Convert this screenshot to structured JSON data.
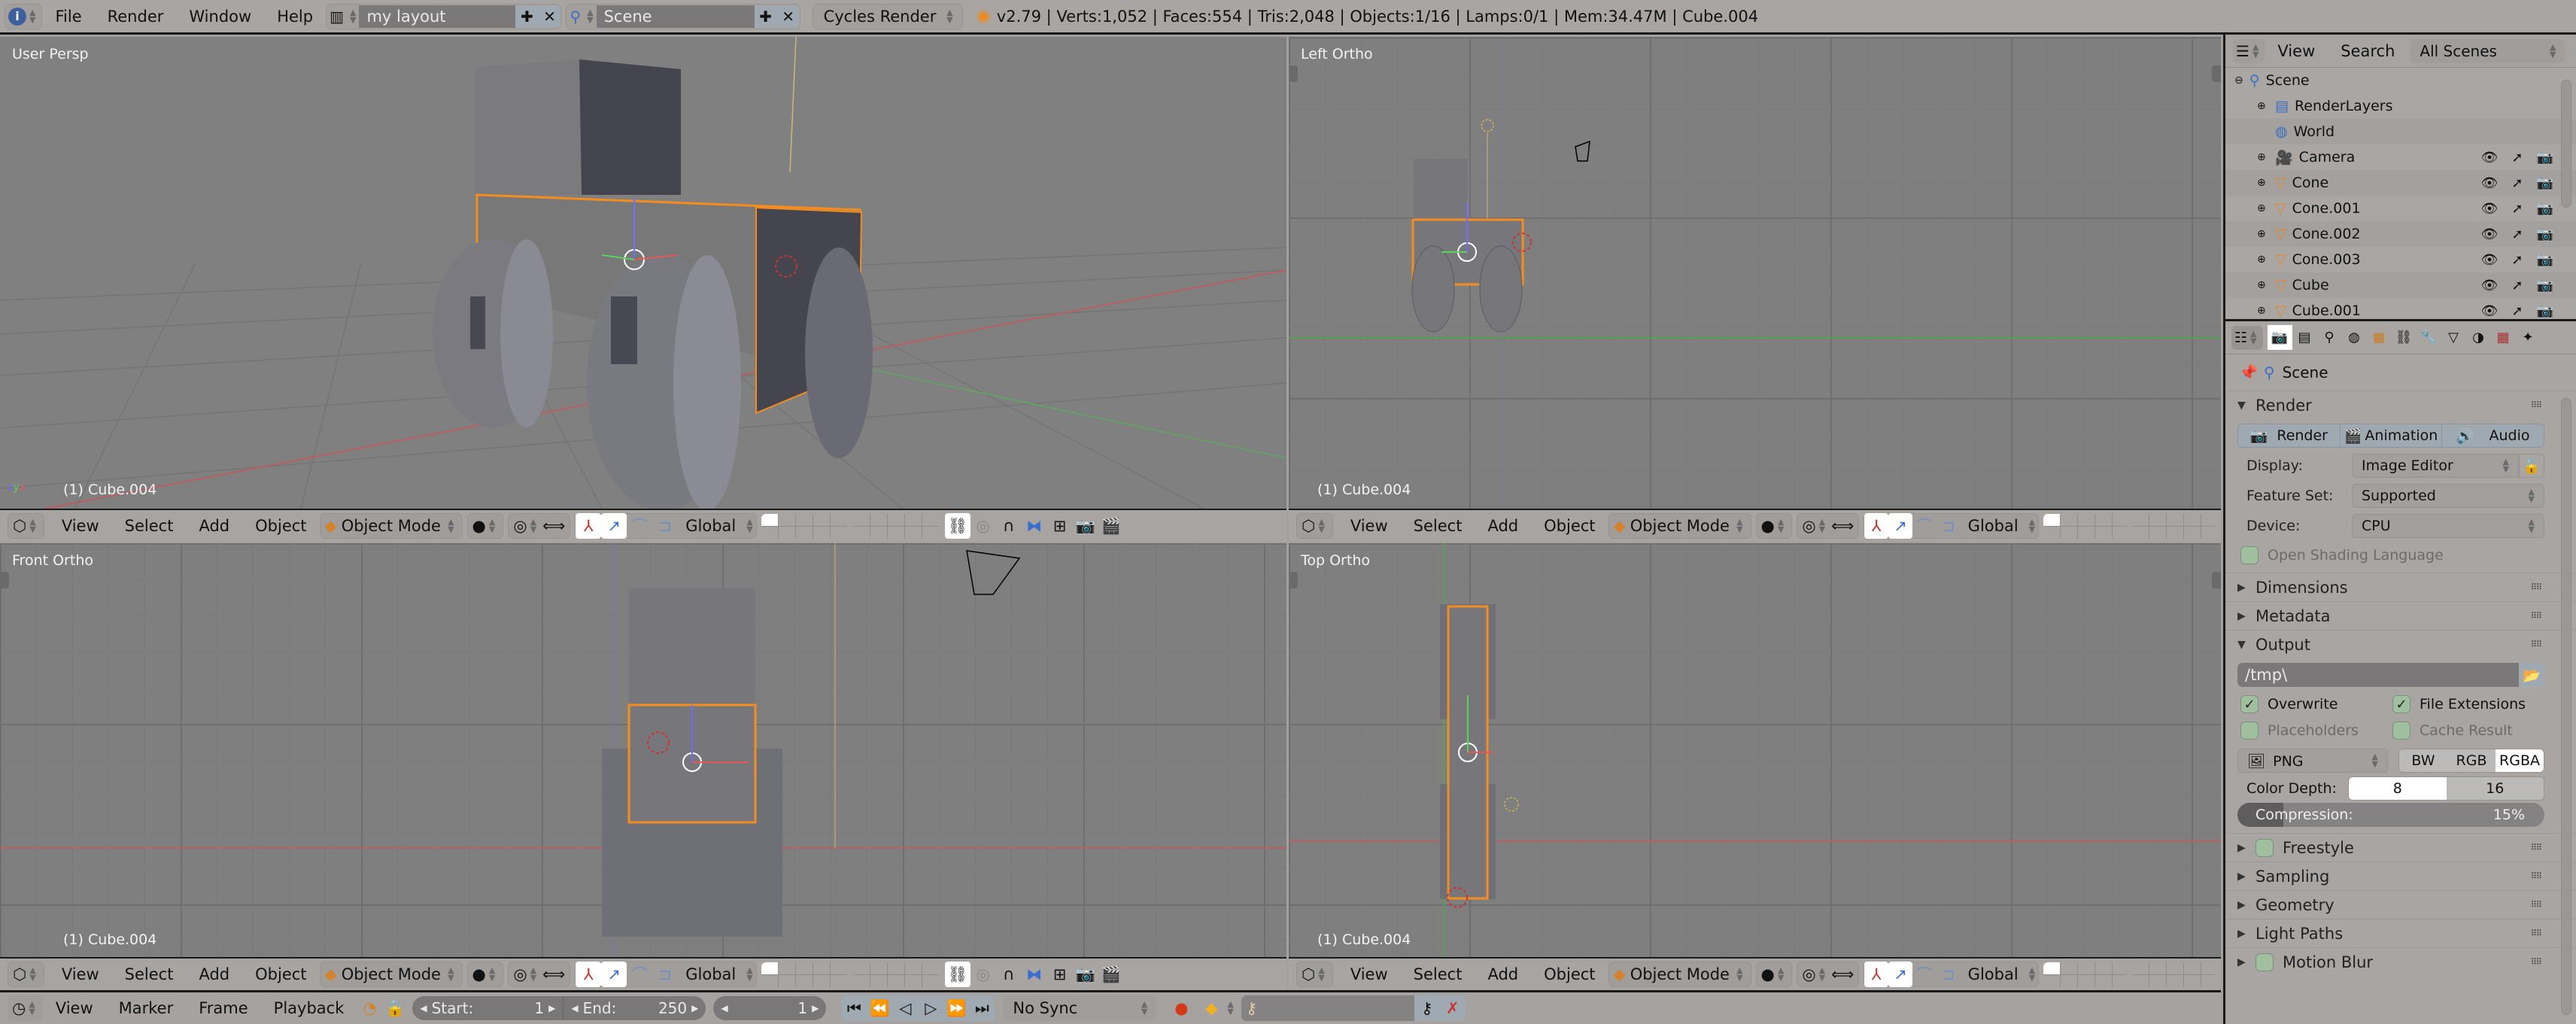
{
  "info_header": {
    "editor_icon": "info-icon",
    "menus": [
      "File",
      "Render",
      "Window",
      "Help"
    ],
    "layout_name": "my layout",
    "scene_name": "Scene",
    "render_engine": "Cycles Render",
    "stats": "v2.79 | Verts:1,052 | Faces:554 | Tris:2,048 | Objects:1/16 | Lamps:0/1 | Mem:34.47M | Cube.004"
  },
  "viewports": [
    {
      "label": "User Persp",
      "object": "(1) Cube.004"
    },
    {
      "label": "Left Ortho",
      "object": "(1) Cube.004"
    },
    {
      "label": "Front Ortho",
      "object": "(1) Cube.004"
    },
    {
      "label": "Top Ortho",
      "object": "(1) Cube.004"
    }
  ],
  "view3d_header": {
    "menus": [
      "View",
      "Select",
      "Add",
      "Object"
    ],
    "mode": "Object Mode",
    "orientation": "Global"
  },
  "timeline": {
    "menus": [
      "View",
      "Marker",
      "Frame",
      "Playback"
    ],
    "start_label": "Start:",
    "start": "1",
    "end_label": "End:",
    "end": "250",
    "current": "1",
    "sync": "No Sync"
  },
  "outliner": {
    "menus": [
      "View",
      "Search"
    ],
    "display_mode": "All Scenes",
    "root": "Scene",
    "items": [
      {
        "name": "RenderLayers",
        "icon": "renderlayers-icon",
        "vis": false
      },
      {
        "name": "World",
        "icon": "world-icon",
        "vis": false
      },
      {
        "name": "Camera",
        "icon": "camera-object-icon",
        "vis": true
      },
      {
        "name": "Cone",
        "icon": "mesh-icon",
        "vis": true
      },
      {
        "name": "Cone.001",
        "icon": "mesh-icon",
        "vis": true
      },
      {
        "name": "Cone.002",
        "icon": "mesh-icon",
        "vis": true
      },
      {
        "name": "Cone.003",
        "icon": "mesh-icon",
        "vis": true
      },
      {
        "name": "Cube",
        "icon": "mesh-icon",
        "vis": true
      },
      {
        "name": "Cube.001",
        "icon": "mesh-icon",
        "vis": true
      }
    ]
  },
  "properties": {
    "context": "Scene",
    "render_panel": {
      "title": "Render",
      "buttons": [
        "Render",
        "Animation",
        "Audio"
      ],
      "display_label": "Display:",
      "display_value": "Image Editor",
      "feature_set_label": "Feature Set:",
      "feature_set_value": "Supported",
      "device_label": "Device:",
      "device_value": "CPU",
      "osl_label": "Open Shading Language"
    },
    "collapsed_top": [
      "Dimensions",
      "Metadata"
    ],
    "output_panel": {
      "title": "Output",
      "path": "/tmp\\",
      "overwrite": "Overwrite",
      "file_extensions": "File Extensions",
      "placeholders": "Placeholders",
      "cache_result": "Cache Result",
      "format": "PNG",
      "color_modes": [
        "BW",
        "RGB",
        "RGBA"
      ],
      "color_mode_selected": "RGBA",
      "color_depth_label": "Color Depth:",
      "color_depths": [
        "8",
        "16"
      ],
      "color_depth_selected": "8",
      "compression_label": "Compression:",
      "compression": "15%"
    },
    "collapsed_bottom": [
      {
        "title": "Freestyle",
        "checkbox": true
      },
      {
        "title": "Sampling",
        "checkbox": false
      },
      {
        "title": "Geometry",
        "checkbox": false
      },
      {
        "title": "Light Paths",
        "checkbox": false
      },
      {
        "title": "Motion Blur",
        "checkbox": true
      }
    ]
  },
  "colors": {
    "selection": "#f58c1e",
    "x_axis": "#e85656",
    "y_axis": "#5bd35b",
    "z_axis": "#6e6efa"
  }
}
